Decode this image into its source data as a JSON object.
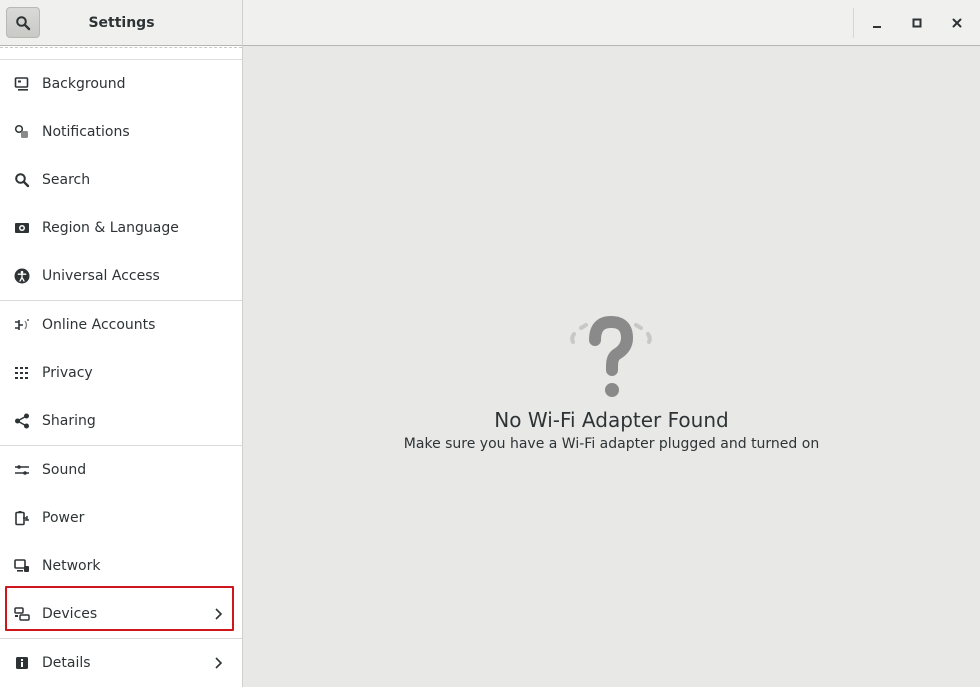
{
  "window": {
    "title": "Settings",
    "controls": {
      "minimize": "minimize-icon",
      "maximize": "maximize-icon",
      "close": "close-icon"
    }
  },
  "sidebar": {
    "groups": [
      [
        {
          "label": "Background",
          "icon": "background-icon"
        },
        {
          "label": "Notifications",
          "icon": "notifications-icon"
        },
        {
          "label": "Search",
          "icon": "search-icon"
        },
        {
          "label": "Region & Language",
          "icon": "region-language-icon"
        },
        {
          "label": "Universal Access",
          "icon": "universal-access-icon"
        }
      ],
      [
        {
          "label": "Online Accounts",
          "icon": "online-accounts-icon"
        },
        {
          "label": "Privacy",
          "icon": "privacy-icon"
        },
        {
          "label": "Sharing",
          "icon": "sharing-icon"
        }
      ],
      [
        {
          "label": "Sound",
          "icon": "sound-icon"
        },
        {
          "label": "Power",
          "icon": "power-icon"
        },
        {
          "label": "Network",
          "icon": "network-icon"
        },
        {
          "label": "Devices",
          "icon": "devices-icon",
          "has_submenu": true,
          "highlighted": true
        }
      ],
      [
        {
          "label": "Details",
          "icon": "details-icon",
          "has_submenu": true
        }
      ]
    ]
  },
  "main": {
    "status": {
      "icon": "question-mark-icon",
      "title": "No Wi-Fi Adapter Found",
      "description": "Make sure you have a Wi-Fi adapter plugged and turned on"
    }
  },
  "colors": {
    "highlight_border": "#d0151d",
    "content_bg": "#e8e8e7",
    "sidebar_bg": "#ffffff",
    "icon_gray": "#8a8a8a"
  }
}
